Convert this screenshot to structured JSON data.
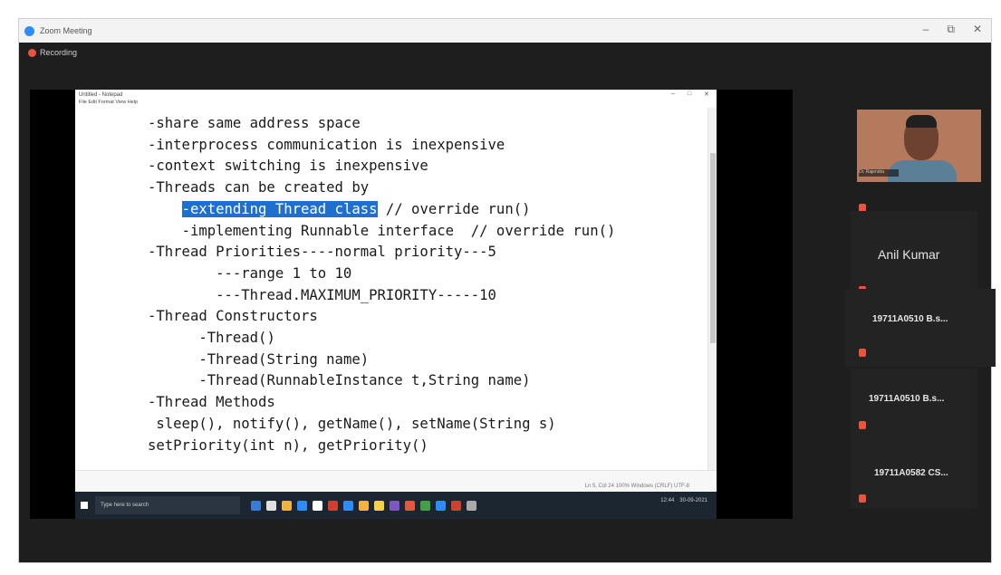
{
  "zoom": {
    "title": "Zoom Meeting",
    "recording_label": "Recording",
    "window_controls": [
      "–",
      "⧉",
      "✕"
    ]
  },
  "notepad": {
    "title": "Untitled - Notepad",
    "menu": "File  Edit  Format  View  Help",
    "controls": [
      "–",
      "□",
      "✕"
    ],
    "lines": [
      "-share same address space",
      "-interprocess communication is inexpensive",
      "-context switching is inexpensive",
      "-Threads can be created by",
      "-implementing Runnable interface  // override run()",
      "-Thread Priorities----normal priority---5",
      "---range 1 to 10",
      "---Thread.MAXIMUM_PRIORITY-----10",
      "-Thread Constructors",
      "-Thread()",
      "-Thread(String name)",
      "-Thread(RunnableInstance t,String name)",
      "-Thread Methods",
      "sleep(), notify(), getName(), setName(String s)",
      "setPriority(int n), getPriority()"
    ],
    "selected_text": "-extending Thread class",
    "after_selected": " // override run()",
    "status": "Ln 5, Col 24   100%   Windows (CRLF)   UTF-8"
  },
  "taskbar": {
    "search_placeholder": "Type here to search",
    "time": "12:44",
    "date": "30-09-2021",
    "app_colors": [
      "#3a7bd5",
      "#e0e0e0",
      "#f2b33d",
      "#2d8cff",
      "#ffffff",
      "#d23f31",
      "#2d8cff",
      "#f2b33d",
      "#f7d046",
      "#7e57c2",
      "#e8543d",
      "#43a047",
      "#2d8cff",
      "#d23f31",
      "#aaaaaa"
    ]
  },
  "participants": {
    "self_label": "Dr. Rajendra",
    "anil": "Anil Kumar",
    "p1": "19711A0510 B.s...",
    "p2": "19711A0510 B.s...",
    "p3": "19711A0582 CS..."
  },
  "colors": {
    "selection": "#1f6fd1",
    "muted_mic": "#e8543d",
    "zoom_blue": "#2d8cff"
  }
}
